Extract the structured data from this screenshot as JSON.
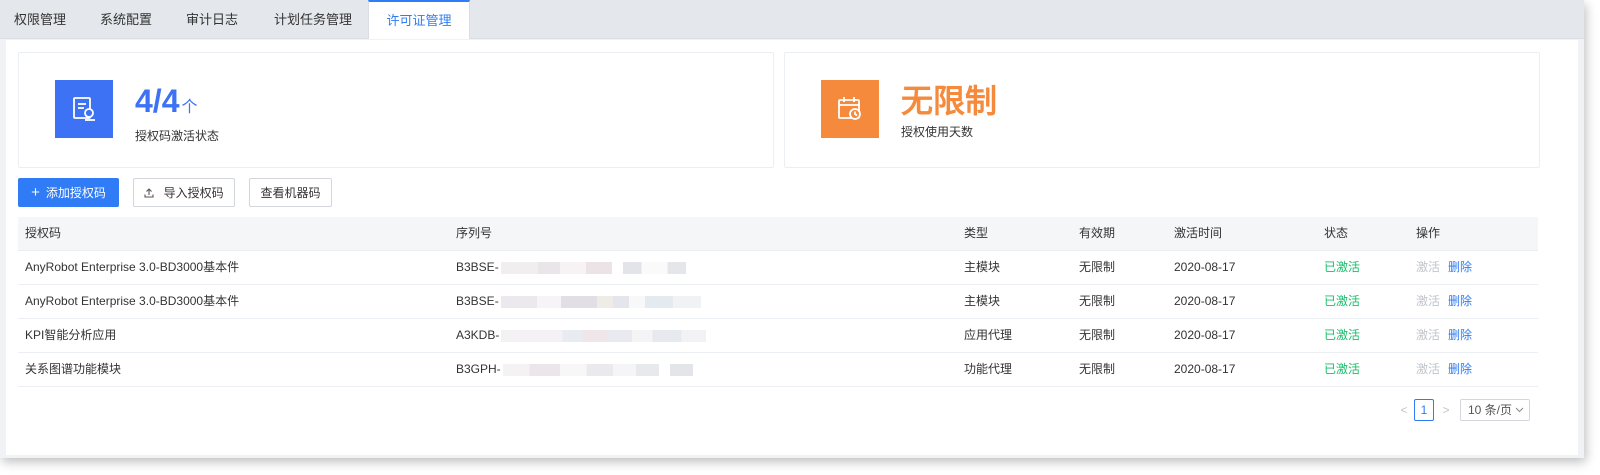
{
  "tabs": [
    {
      "label": "权限管理",
      "active": false
    },
    {
      "label": "系统配置",
      "active": false
    },
    {
      "label": "审计日志",
      "active": false
    },
    {
      "label": "计划任务管理",
      "active": false
    },
    {
      "label": "许可证管理",
      "active": true
    }
  ],
  "stats": {
    "activation": {
      "value": "4/4",
      "unit": "个",
      "label": "授权码激活状态",
      "color": "#3d72f5",
      "icon": "license-document-icon"
    },
    "days": {
      "value": "无限制",
      "label": "授权使用天数",
      "color": "#f58a3c",
      "icon": "calendar-clock-icon"
    }
  },
  "toolbar": {
    "add_label": "添加授权码",
    "import_label": "导入授权码",
    "machine_label": "查看机器码"
  },
  "table": {
    "headers": [
      "授权码",
      "序列号",
      "类型",
      "有效期",
      "激活时间",
      "状态",
      "操作"
    ],
    "rows": [
      {
        "code": "AnyRobot Enterprise 3.0-BD3000基本件",
        "serial": "B3BSE-",
        "type": "主模块",
        "validity": "无限制",
        "activated": "2020-08-17",
        "status": "已激活",
        "op_activate": "激活",
        "op_delete": "删除"
      },
      {
        "code": "AnyRobot Enterprise 3.0-BD3000基本件",
        "serial": "B3BSE-",
        "type": "主模块",
        "validity": "无限制",
        "activated": "2020-08-17",
        "status": "已激活",
        "op_activate": "激活",
        "op_delete": "删除"
      },
      {
        "code": "KPI智能分析应用",
        "serial": "A3KDB-",
        "type": "应用代理",
        "validity": "无限制",
        "activated": "2020-08-17",
        "status": "已激活",
        "op_activate": "激活",
        "op_delete": "删除"
      },
      {
        "code": "关系图谱功能模块",
        "serial": "B3GPH-",
        "type": "功能代理",
        "validity": "无限制",
        "activated": "2020-08-17",
        "status": "已激活",
        "op_activate": "激活",
        "op_delete": "删除"
      }
    ]
  },
  "pagination": {
    "prev": "<",
    "current": "1",
    "next": ">",
    "page_size": "10 条/页"
  }
}
